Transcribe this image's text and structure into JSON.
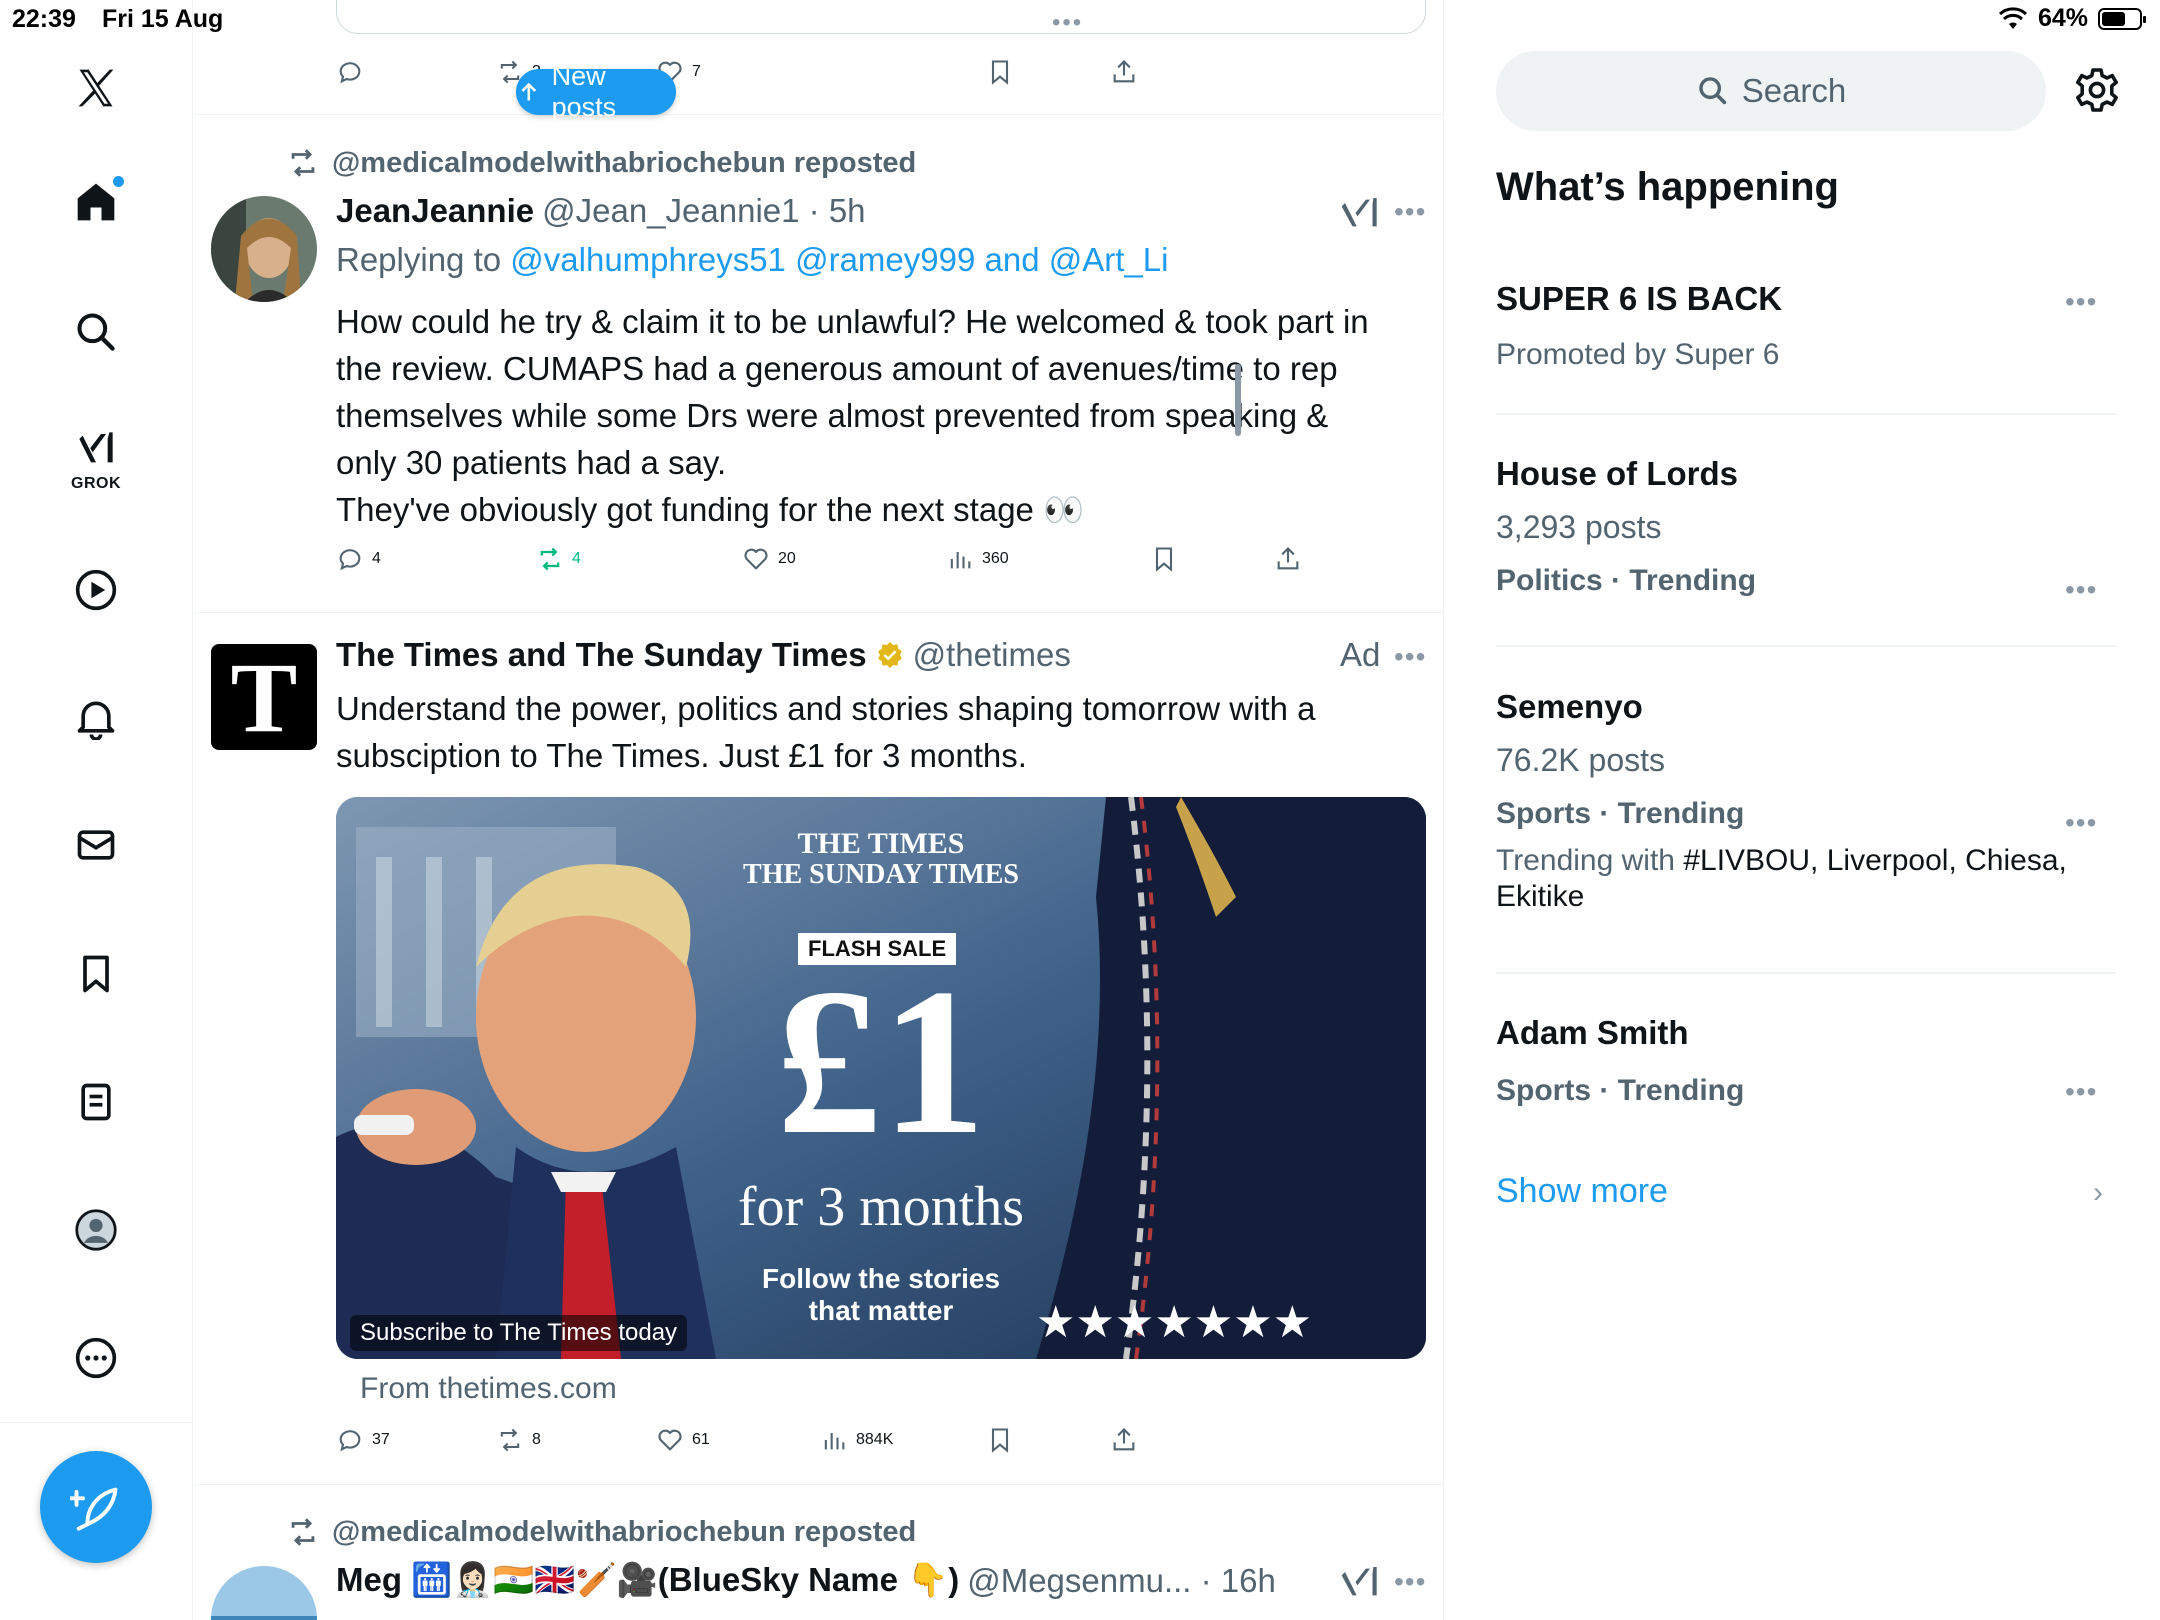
{
  "status_bar": {
    "time": "22:39",
    "date": "Fri 15 Aug",
    "battery_text": "64%",
    "battery_level": 0.64
  },
  "left_nav": {
    "items": [
      "x-logo",
      "home",
      "explore",
      "grok",
      "video",
      "notifications",
      "messages",
      "bookmarks",
      "lists",
      "profile",
      "more"
    ],
    "grok_label": "GROK"
  },
  "feed": {
    "new_posts_label": "New posts",
    "top_post_actions": {
      "replies": "",
      "reposts": "3",
      "likes": "7"
    },
    "post1": {
      "repost_by": "@medicalmodelwithabriochebun reposted",
      "name": "JeanJeannie",
      "handle_time": "@Jean_Jeannie1 · 5h",
      "replying_prefix": "Replying to",
      "replying_to": "@valhumphreys51 @ramey999 and @Art_Li",
      "text_lines": [
        "How could he try & claim it to be unlawful? He welcomed & took part in",
        "the review. CUMAPS had a generous amount of avenues/time to rep",
        "themselves while some Drs were almost prevented from speaking &",
        "only 30 patients had a say.",
        "They've obviously got funding for the next stage 👀"
      ],
      "replies": "4",
      "reposts": "4",
      "likes": "20",
      "views": "360"
    },
    "post2": {
      "name": "The Times and The Sunday Times",
      "handle": "@thetimes",
      "ad_label": "Ad",
      "avatar_letter": "T",
      "text_lines": [
        "Understand the power, politics and stories shaping tomorrow with a",
        "subsciption to The Times. Just £1 for 3 months."
      ],
      "image": {
        "brand_line1": "THE TIMES",
        "brand_line2": "THE SUNDAY TIMES",
        "badge": "FLASH SALE",
        "price": "£1",
        "duration": "for 3 months",
        "tagline1": "Follow the stories",
        "tagline2": "that matter",
        "caption": "Subscribe to The Times today"
      },
      "from": "From thetimes.com",
      "replies": "37",
      "reposts": "8",
      "likes": "61",
      "views": "884K"
    },
    "post3": {
      "repost_by": "@medicalmodelwithabriochebun reposted",
      "name": "Meg 🛗👩🏻‍⚕️🇮🇳🇬🇧🏏🎥(BlueSky Name 👇)",
      "handle_time": "@Megsenmu... · 16h"
    }
  },
  "right": {
    "search_placeholder": "Search",
    "section_title": "What’s happening",
    "trends": [
      {
        "title": "SUPER 6 IS BACK",
        "sub": "Promoted by Super 6"
      },
      {
        "title": "House of Lords",
        "sub": "3,293 posts",
        "cat": "Politics · Trending"
      },
      {
        "title": "Semenyo",
        "sub": "76.2K posts",
        "cat": "Sports · Trending",
        "with_prefix": "Trending with",
        "with_terms": "#LIVBOU, Liverpool, Chiesa, Ekitike"
      },
      {
        "title": "Adam Smith",
        "cat": "Sports · Trending"
      }
    ],
    "show_more": "Show more"
  },
  "colors": {
    "accent": "#1d9bf0",
    "repost_green": "#00ba7c",
    "muted": "#536471"
  }
}
